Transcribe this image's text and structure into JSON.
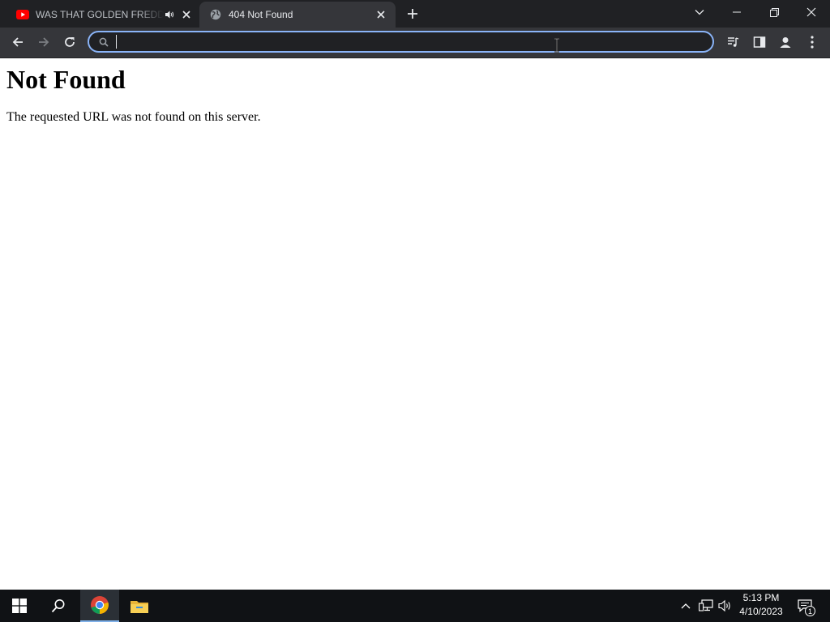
{
  "tabs": [
    {
      "title": "WAS THAT GOLDEN FREDDY",
      "icon": "youtube-icon",
      "audio": "speaker-icon",
      "active": false
    },
    {
      "title": "404 Not Found",
      "icon": "globe-icon",
      "active": true
    }
  ],
  "toolbar": {
    "address_value": "",
    "buttons": [
      "back-icon",
      "forward-icon",
      "reload-icon",
      "media-queue-icon",
      "side-panel-icon",
      "profile-icon",
      "kebab-menu-icon"
    ]
  },
  "page": {
    "heading": "Not Found",
    "message": "The requested URL was not found on this server."
  },
  "taskbar": {
    "time": "5:13 PM",
    "date": "4/10/2023",
    "notification_count": "1",
    "pinned": [
      "windows-start-icon",
      "search-icon",
      "chrome-icon",
      "file-explorer-icon"
    ]
  },
  "colors": {
    "tabstrip_bg": "#202124",
    "active_tab_bg": "#35363a",
    "omnibox_focus": "#8ab4f8",
    "taskbar_bg": "#101215"
  }
}
